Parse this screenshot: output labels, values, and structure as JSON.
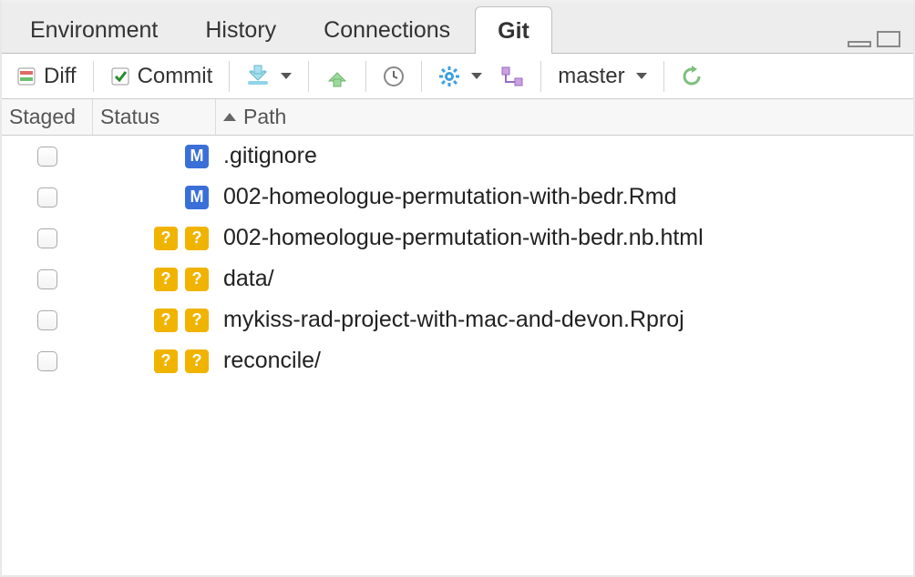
{
  "tabs": [
    {
      "label": "Environment",
      "active": false
    },
    {
      "label": "History",
      "active": false
    },
    {
      "label": "Connections",
      "active": false
    },
    {
      "label": "Git",
      "active": true
    }
  ],
  "toolbar": {
    "diff_label": "Diff",
    "commit_label": "Commit",
    "branch_label": "master"
  },
  "columns": {
    "staged": "Staged",
    "status": "Status",
    "path": "Path"
  },
  "files": [
    {
      "staged": false,
      "status1": "",
      "status2": "M",
      "path": ".gitignore"
    },
    {
      "staged": false,
      "status1": "",
      "status2": "M",
      "path": "002-homeologue-permutation-with-bedr.Rmd"
    },
    {
      "staged": false,
      "status1": "?",
      "status2": "?",
      "path": "002-homeologue-permutation-with-bedr.nb.html"
    },
    {
      "staged": false,
      "status1": "?",
      "status2": "?",
      "path": "data/"
    },
    {
      "staged": false,
      "status1": "?",
      "status2": "?",
      "path": "mykiss-rad-project-with-mac-and-devon.Rproj"
    },
    {
      "staged": false,
      "status1": "?",
      "status2": "?",
      "path": "reconcile/"
    }
  ]
}
